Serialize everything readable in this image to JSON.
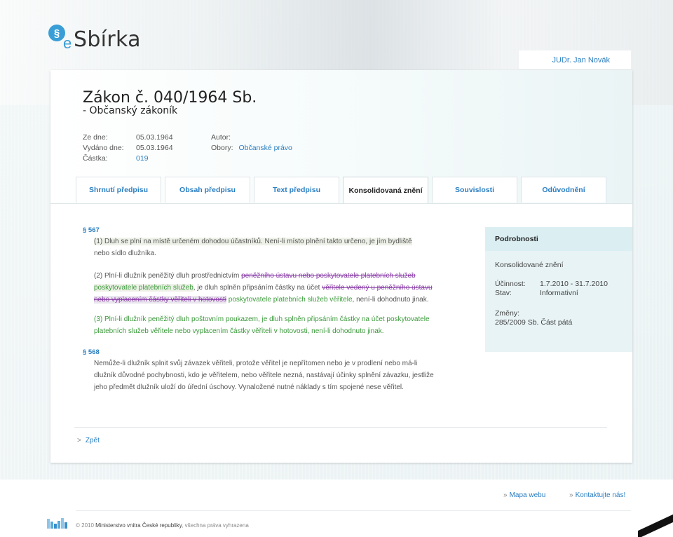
{
  "logo": {
    "symbol": "§",
    "e": "e",
    "name": "Sbírka"
  },
  "user": {
    "name": "JUDr. Jan Novák"
  },
  "law": {
    "title": "Zákon č. 040/1964 Sb.",
    "subtitle": "- Občanský zákoník",
    "date_label": "Ze dne:",
    "date": "05.03.1964",
    "issued_label": "Vydáno dne:",
    "issued": "05.03.1964",
    "part_label": "Částka:",
    "part": "019",
    "author_label": "Autor:",
    "fields_label": "Obory:",
    "fields": "Občanské právo"
  },
  "tabs": [
    {
      "label": "Shrnutí předpisu"
    },
    {
      "label": "Obsah předpisu"
    },
    {
      "label": "Text předpisu"
    },
    {
      "label": "Konsolidovaná znění"
    },
    {
      "label": "Souvislosti"
    },
    {
      "label": "Odůvodnění"
    }
  ],
  "active_tab": "Konsolidovaná znění",
  "sections": {
    "s567": {
      "heading": "§ 567",
      "p1a": "(1) Dluh se plní na místě určeném dohodou účastníků. Není-li místo plnění takto určeno, je jím bydliště",
      "p1b": "nebo sídlo dlužníka.",
      "p2_a": "(2) Plní-li dlužník peněžitý dluh prostřednictvím ",
      "p2_del1": "peněžního ústavu nebo poskytovatele platebních služeb",
      "p2_ins1": "poskytovatele platebních služeb",
      "p2_b": ", je dluh splněn připsáním částky na účet ",
      "p2_del2a": "věřitele vedený u peněžního ústavu",
      "p2_del2b": "nebo vyplacením částky věřiteli v hotovosti",
      "p2_ins2": " poskytovatele platebních služeb věřitele",
      "p2_c": ", není-li dohodnuto jinak.",
      "p3a": "(3) Plní-li dlužník peněžitý dluh poštovním poukazem, je dluh splněn připsáním částky na účet poskytovatele",
      "p3b": "platebních služeb věřitele nebo vyplacením částky věřiteli v hotovosti, není-li dohodnuto jinak."
    },
    "s568": {
      "heading": "§ 568",
      "l1": "Nemůže-li dlužník splnit svůj závazek věřiteli, protože věřitel je nepřítomen nebo je v prodlení nebo má-li",
      "l2": "dlužník důvodné pochybnosti, kdo je věřitelem, nebo věřitele nezná, nastávají účinky splnění závazku, jestliže",
      "l3": "jeho předmět dlužník uloží do úřední úschovy. Vynaložené nutné náklady s tím spojené nese věřitel."
    }
  },
  "details": {
    "heading": "Podrobnosti",
    "type": "Konsolidované znění",
    "effect_label": "Účinnost:",
    "effect": "1.7.2010 - 31.7.2010",
    "state_label": "Stav:",
    "state": "Informativní",
    "changes_label": "Změny:",
    "changes": "285/2009 Sb. Část pátá"
  },
  "back": {
    "arrow": ">",
    "label": "Zpět"
  },
  "footer": {
    "links": [
      {
        "arrow": "»",
        "label": "Mapa webu"
      },
      {
        "arrow": "»",
        "label": "Kontaktujte nás!"
      }
    ],
    "copy_prefix": "© 2010",
    "copy_org": "Ministerstvo vnitra České republiky",
    "copy_suffix": ", všechna práva vyhrazena"
  }
}
